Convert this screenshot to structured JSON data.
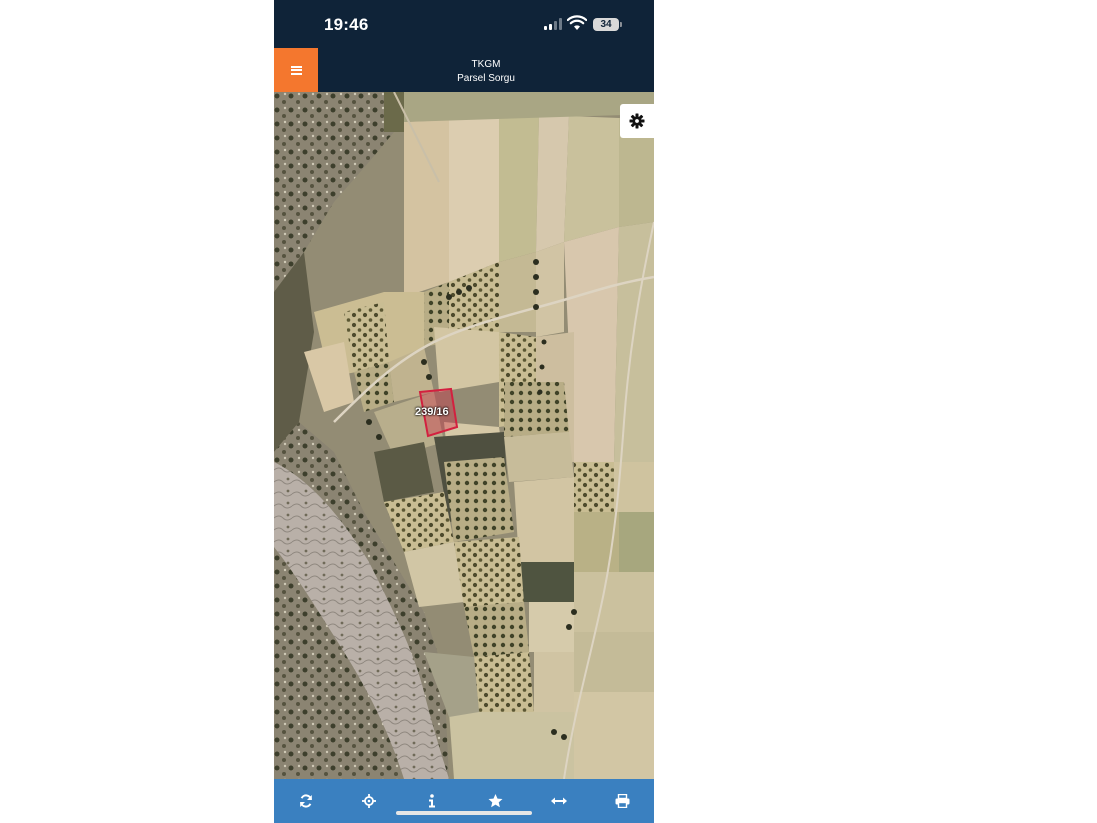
{
  "status_bar": {
    "time": "19:46",
    "battery_level": "34",
    "signal_bars_active": 2
  },
  "header": {
    "title": "TKGM",
    "subtitle": "Parsel Sorgu",
    "menu_icon": "hamburger-icon",
    "accent_color": "#f4772e",
    "bar_color": "#0f2338"
  },
  "map": {
    "parcel_label": "239/16",
    "parcel_color": "#d3203f",
    "settings_icon": "gear-icon"
  },
  "toolbar": {
    "color": "#3a80c0",
    "buttons": [
      {
        "name": "refresh-button",
        "icon": "refresh-icon"
      },
      {
        "name": "locate-button",
        "icon": "crosshair-icon"
      },
      {
        "name": "info-button",
        "icon": "info-icon"
      },
      {
        "name": "favorite-button",
        "icon": "star-icon"
      },
      {
        "name": "measure-button",
        "icon": "measure-icon"
      },
      {
        "name": "print-button",
        "icon": "print-icon"
      }
    ]
  }
}
